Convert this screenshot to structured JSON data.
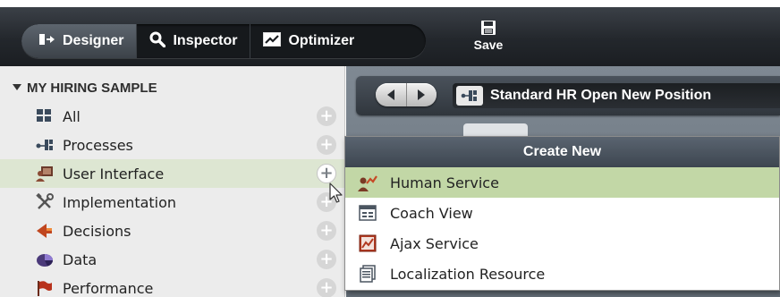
{
  "toolbar": {
    "tabs": [
      {
        "label": "Designer",
        "icon": "designer-icon",
        "active": true
      },
      {
        "label": "Inspector",
        "icon": "magnifier-icon",
        "active": false
      },
      {
        "label": "Optimizer",
        "icon": "optimizer-chart-icon",
        "active": false
      }
    ],
    "save_label": "Save",
    "save_icon": "save-disk-icon"
  },
  "library": {
    "title": "MY HIRING SAMPLE",
    "items": [
      {
        "label": "All",
        "icon": "grid-icon"
      },
      {
        "label": "Processes",
        "icon": "process-icon"
      },
      {
        "label": "User Interface",
        "icon": "user-interface-icon",
        "highlighted": true
      },
      {
        "label": "Implementation",
        "icon": "tools-icon"
      },
      {
        "label": "Decisions",
        "icon": "decision-arrow-icon"
      },
      {
        "label": "Data",
        "icon": "data-pie-icon"
      },
      {
        "label": "Performance",
        "icon": "flag-icon"
      }
    ],
    "add_symbol": "+"
  },
  "editor": {
    "breadcrumb_title": "Standard HR Open New Position",
    "back_icon": "arrow-left-icon",
    "forward_icon": "arrow-right-icon"
  },
  "create_new": {
    "title": "Create New",
    "items": [
      {
        "label": "Human Service",
        "icon": "human-service-icon",
        "highlighted": true
      },
      {
        "label": "Coach View",
        "icon": "coach-view-icon"
      },
      {
        "label": "Ajax Service",
        "icon": "ajax-service-icon"
      },
      {
        "label": "Localization Resource",
        "icon": "localization-resource-icon"
      }
    ]
  },
  "colors": {
    "toolbar_bg": "#23272c",
    "library_bg": "#ececec",
    "library_highlight": "#dde6d2",
    "popup_header": "#4b5560",
    "popup_highlight": "#c2d7a6"
  }
}
